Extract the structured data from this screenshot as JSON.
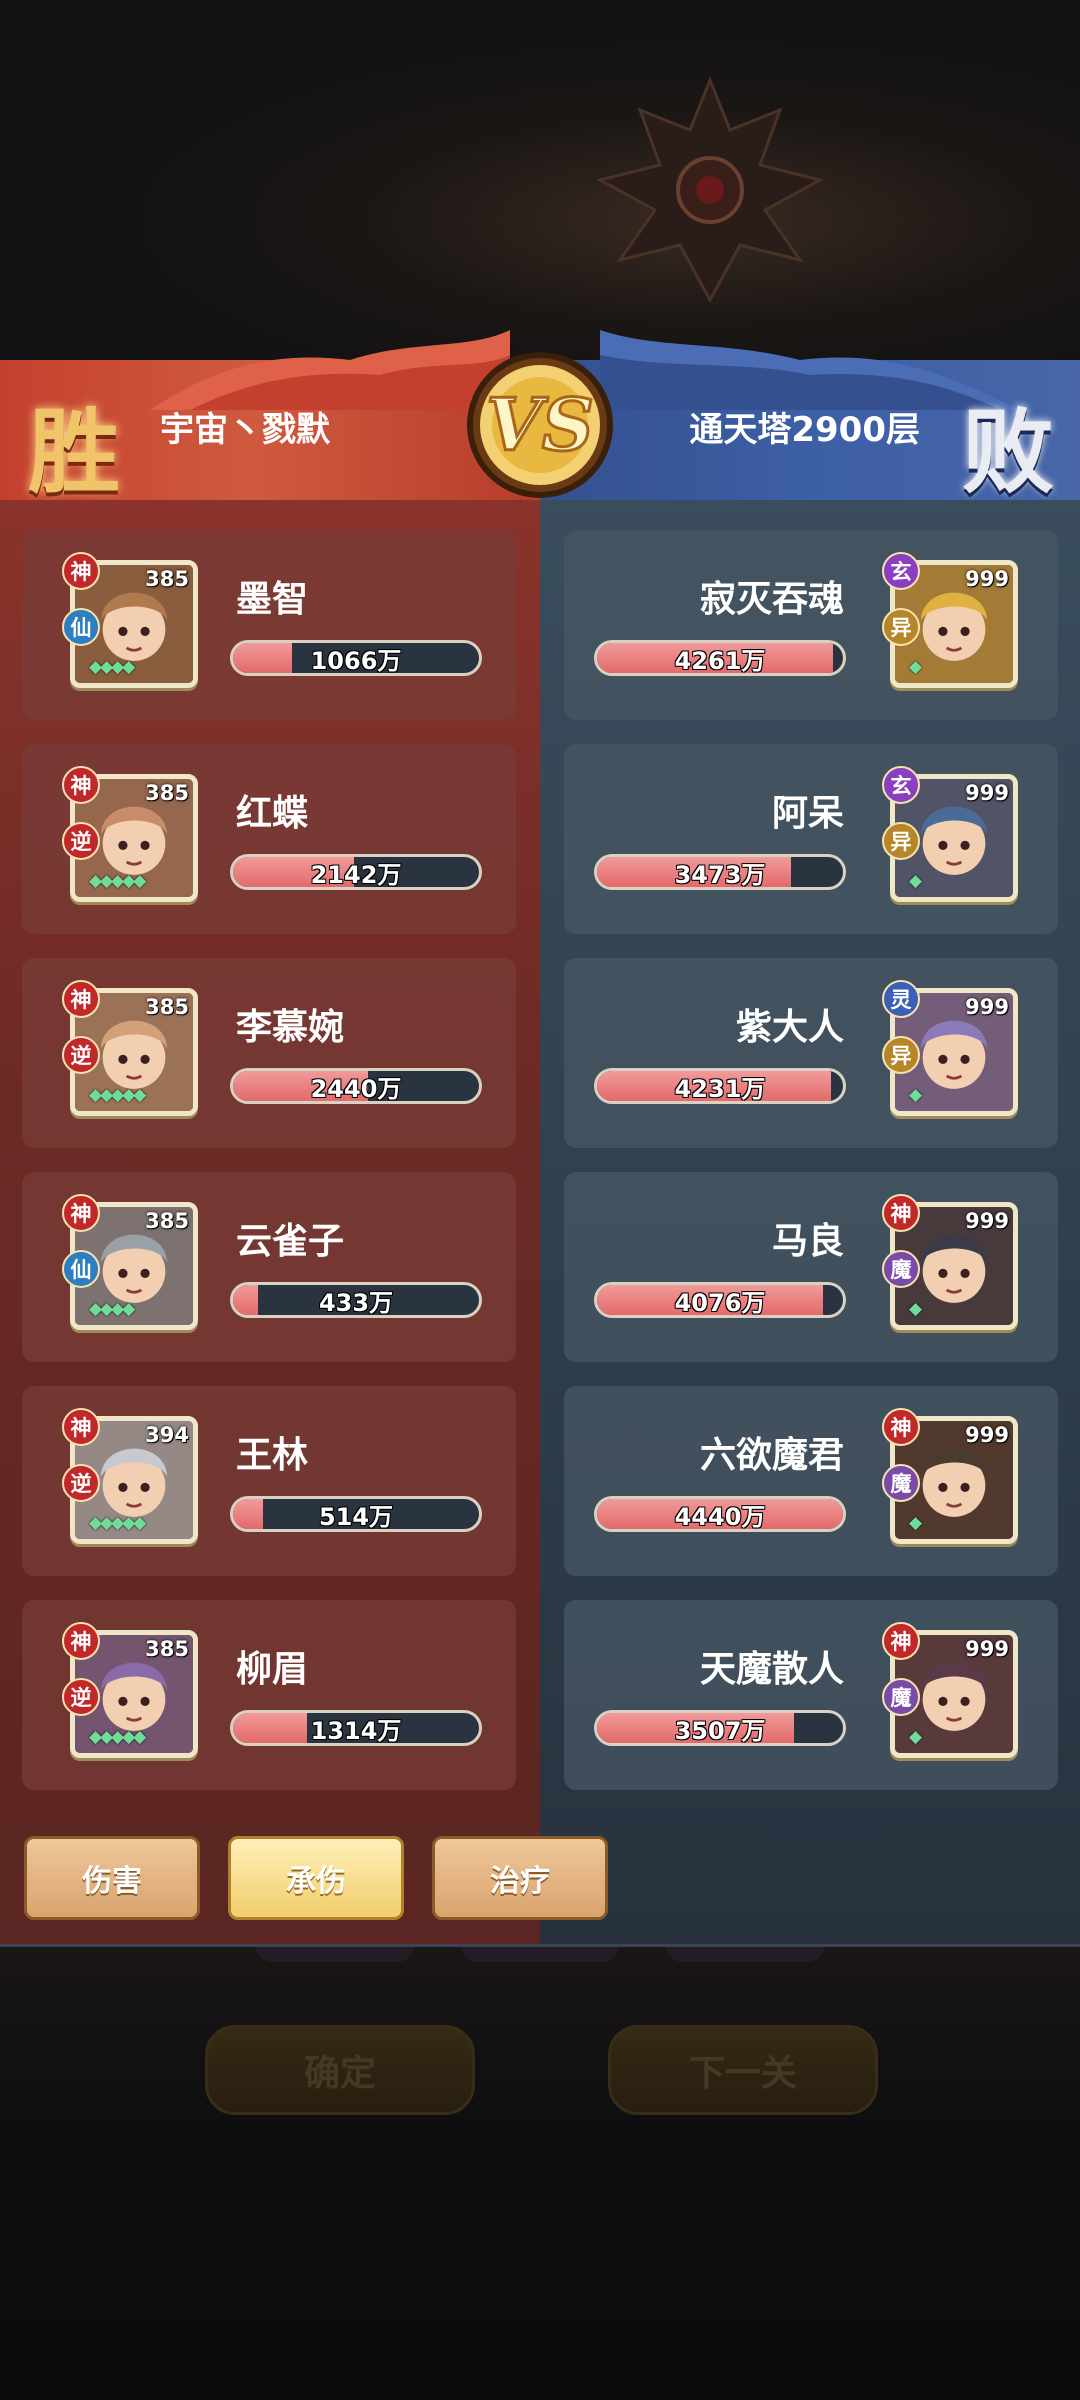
{
  "header": {
    "left_result": "胜",
    "right_result": "败",
    "left_team": "宇宙丶戮默",
    "right_team": "通天塔2900层",
    "vs_label": "VS"
  },
  "colors": {
    "win_panel": "#6d2a25",
    "lose_panel": "#2e3d4b",
    "bar_fill": "#e26a6a",
    "tab_active": "#f2cd6c"
  },
  "left_heroes": [
    {
      "name": "墨智",
      "level": "385",
      "badge1": "神",
      "badge2": "仙",
      "value": "1066万",
      "fill": 0.24,
      "gems": "◆◆◆◆"
    },
    {
      "name": "红蝶",
      "level": "385",
      "badge1": "神",
      "badge2": "逆",
      "value": "2142万",
      "fill": 0.49,
      "gems": "◆◆◆◆◆"
    },
    {
      "name": "李慕婉",
      "level": "385",
      "badge1": "神",
      "badge2": "逆",
      "value": "2440万",
      "fill": 0.55,
      "gems": "◆◆◆◆◆"
    },
    {
      "name": "云雀子",
      "level": "385",
      "badge1": "神",
      "badge2": "仙",
      "value": "433万",
      "fill": 0.1,
      "gems": "◆◆◆◆"
    },
    {
      "name": "王林",
      "level": "394",
      "badge1": "神",
      "badge2": "逆",
      "value": "514万",
      "fill": 0.12,
      "gems": "◆◆◆◆◆"
    },
    {
      "name": "柳眉",
      "level": "385",
      "badge1": "神",
      "badge2": "逆",
      "value": "1314万",
      "fill": 0.3,
      "gems": "◆◆◆◆◆"
    }
  ],
  "right_heroes": [
    {
      "name": "寂灭吞魂",
      "level": "999",
      "badge1": "玄",
      "badge2": "异",
      "value": "4261万",
      "fill": 0.96,
      "gems": "◆"
    },
    {
      "name": "阿呆",
      "level": "999",
      "badge1": "玄",
      "badge2": "异",
      "value": "3473万",
      "fill": 0.79,
      "gems": "◆"
    },
    {
      "name": "紫大人",
      "level": "999",
      "badge1": "灵",
      "badge2": "异",
      "value": "4231万",
      "fill": 0.95,
      "gems": "◆"
    },
    {
      "name": "马良",
      "level": "999",
      "badge1": "神",
      "badge2": "魔",
      "value": "4076万",
      "fill": 0.92,
      "gems": "◆"
    },
    {
      "name": "六欲魔君",
      "level": "999",
      "badge1": "神",
      "badge2": "魔",
      "value": "4440万",
      "fill": 1.0,
      "gems": "◆"
    },
    {
      "name": "天魔散人",
      "level": "999",
      "badge1": "神",
      "badge2": "魔",
      "value": "3507万",
      "fill": 0.8,
      "gems": "◆"
    }
  ],
  "tabs": [
    {
      "label": "伤害",
      "active": false
    },
    {
      "label": "承伤",
      "active": true
    },
    {
      "label": "治疗",
      "active": false
    }
  ],
  "footer": {
    "confirm_label": "确定",
    "next_label": "下一关"
  }
}
